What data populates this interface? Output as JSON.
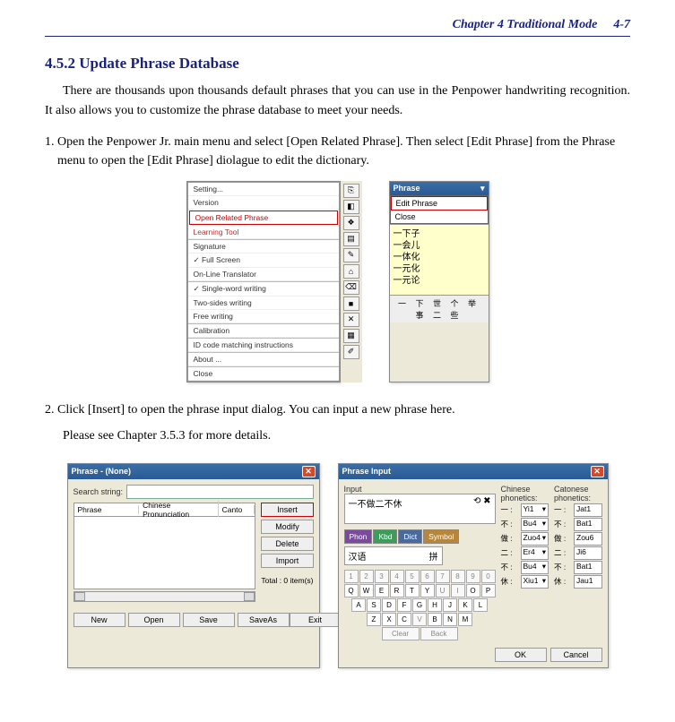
{
  "header": {
    "chapter": "Chapter 4 Traditional Mode",
    "page": "4-7"
  },
  "section": {
    "heading": "4.5.2 Update Phrase Database",
    "intro": "There are thousands upon thousands default phrases that you can use in the Penpower handwriting recognition. It also allows you to customize the phrase database to meet your needs.",
    "step1": "1. Open the Penpower Jr. main menu and select [Open Related Phrase]. Then select [Edit Phrase] from the Phrase menu to open the [Edit Phrase] diolague to edit the dictionary.",
    "step2": "2. Click [Insert] to open the phrase input dialog. You can input a new phrase here.",
    "note": "Please see Chapter 3.5.3 for more details."
  },
  "menu": {
    "items": [
      "Setting...",
      "Version",
      "Open Related Phrase",
      "Learning Tool",
      "Signature",
      "Full Screen",
      "On-Line Translator",
      "Single-word writing",
      "Two-sides writing",
      "Free writing",
      "Calibration",
      "ID code matching instructions",
      "About ...",
      "Close"
    ]
  },
  "phrase_popup": {
    "title": "Phrase",
    "edit": "Edit Phrase",
    "close": "Close",
    "lines": [
      "一下子",
      "一会儿",
      "一体化",
      "一元化",
      "一元论"
    ],
    "footer": "一 下 世 个 举 事 二 些"
  },
  "dlg1": {
    "title": "Phrase - (None)",
    "search": "Search string:",
    "cols": [
      "Phrase",
      "Chinese Pronunciation",
      "Canto"
    ],
    "btns": {
      "insert": "Insert",
      "modify": "Modify",
      "delete": "Delete",
      "import": "Import",
      "exit": "Exit"
    },
    "total": "Total :   0 item(s)",
    "bottom": {
      "new": "New",
      "open": "Open",
      "save": "Save",
      "saveas": "SaveAs"
    }
  },
  "dlg2": {
    "title": "Phrase Input",
    "input_lbl": "Input",
    "input_val": "一不做二不休",
    "chinese_h": "Chinese phonetics:",
    "canton_h": "Catonese phonetics:",
    "chinese": [
      {
        "ch": "一 :",
        "v": "Yi1"
      },
      {
        "ch": "不 :",
        "v": "Bu4"
      },
      {
        "ch": "做 :",
        "v": "Zuo4"
      },
      {
        "ch": "二 :",
        "v": "Er4"
      },
      {
        "ch": "不 :",
        "v": "Bu4"
      },
      {
        "ch": "休 :",
        "v": "Xiu1"
      }
    ],
    "canton": [
      {
        "ch": "一 :",
        "v": "Jat1"
      },
      {
        "ch": "不 :",
        "v": "Bat1"
      },
      {
        "ch": "做 :",
        "v": "Zou6"
      },
      {
        "ch": "二 :",
        "v": "Ji6"
      },
      {
        "ch": "不 :",
        "v": "Bat1"
      },
      {
        "ch": "休 :",
        "v": "Jau1"
      }
    ],
    "tabs": [
      "Phon",
      "Kbd",
      "Dict",
      "Symbol"
    ],
    "pinyin": "汉语",
    "py_right": "拼",
    "kbd": {
      "r1": [
        "1",
        "2",
        "3",
        "4",
        "5",
        "6",
        "7",
        "8",
        "9",
        "0"
      ],
      "r2": [
        "Q",
        "W",
        "E",
        "R",
        "T",
        "Y",
        "U",
        "I",
        "O",
        "P"
      ],
      "r3": [
        "A",
        "S",
        "D",
        "F",
        "G",
        "H",
        "J",
        "K",
        "L"
      ],
      "r4": [
        "Z",
        "X",
        "C",
        "V",
        "B",
        "N",
        "M"
      ],
      "r5": [
        "Clear",
        "Back"
      ]
    },
    "ok": "OK",
    "cancel": "Cancel"
  }
}
